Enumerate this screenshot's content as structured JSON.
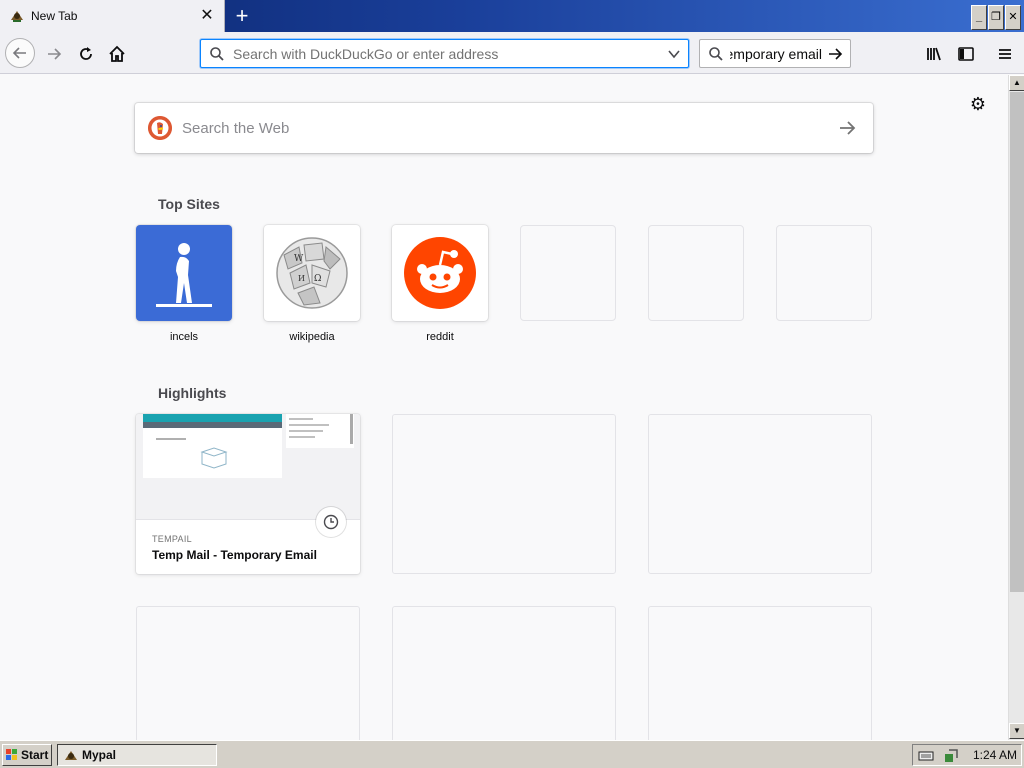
{
  "browser": {
    "tab": {
      "title": "New Tab",
      "close_glyph": "✕"
    },
    "new_tab_glyph": "+",
    "window_controls": {
      "minimize": "_",
      "restore": "❐",
      "close": "✕"
    },
    "urlbar": {
      "placeholder": "Search with DuckDuckGo or enter address",
      "value": ""
    },
    "searchbar": {
      "value": "Temporary email"
    },
    "icons": [
      "back-icon",
      "forward-icon",
      "reload-icon",
      "home-icon",
      "library-icon",
      "sidebar-icon",
      "menu-icon"
    ]
  },
  "newtab": {
    "search": {
      "placeholder": "Search the Web"
    },
    "top_sites_title": "Top Sites",
    "top_sites": [
      {
        "label": "incels",
        "icon": "standing-figure-icon",
        "color": "#3b6bd6"
      },
      {
        "label": "wikipedia",
        "icon": "wikipedia-globe-icon",
        "color": "#ffffff"
      },
      {
        "label": "reddit",
        "icon": "reddit-alien-icon",
        "color": "#ff4500"
      },
      {
        "label": "",
        "icon": ""
      },
      {
        "label": "",
        "icon": ""
      },
      {
        "label": "",
        "icon": ""
      }
    ],
    "highlights_title": "Highlights",
    "highlights": [
      {
        "site": "TEMPAIL",
        "title": "Temp Mail - Temporary Email"
      }
    ]
  },
  "taskbar": {
    "start_label": "Start",
    "task_label": "Mypal",
    "clock": "1:24 AM"
  },
  "colors": {
    "accent": "#0a84ff",
    "titlebar": "#0a246a",
    "reddit": "#ff4500",
    "ddg": "#de5833"
  }
}
